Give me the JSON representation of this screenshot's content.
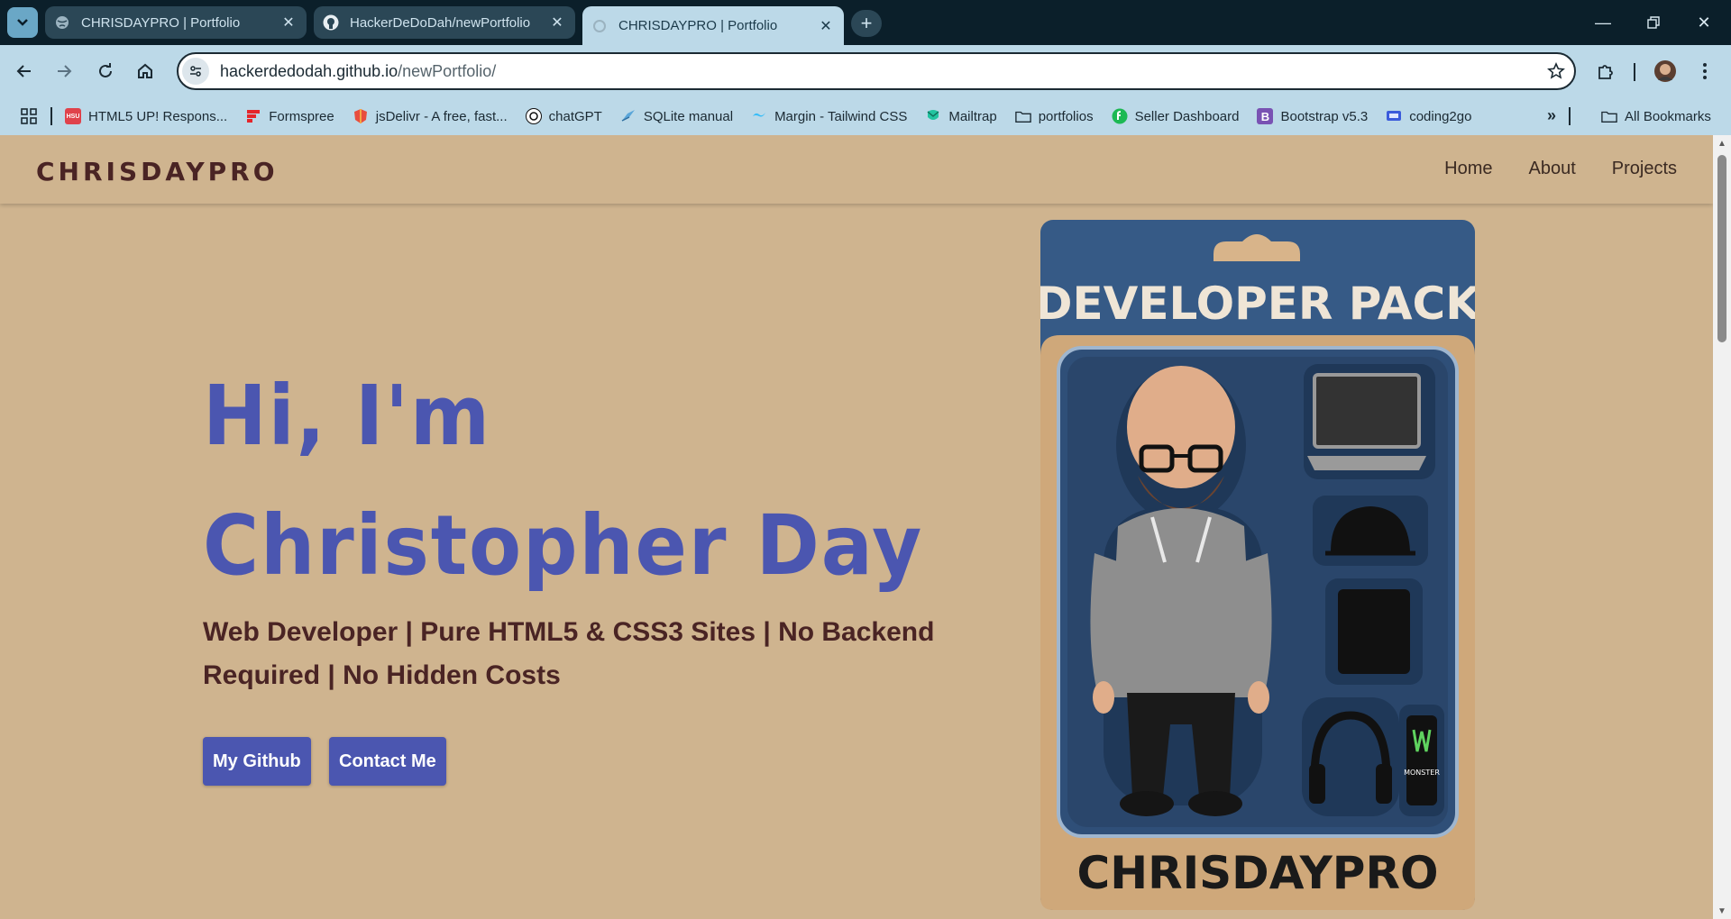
{
  "browser": {
    "tabs": [
      {
        "title": "CHRISDAYPRO | Portfolio",
        "favicon": "globe-icon",
        "active": false
      },
      {
        "title": "HackerDeDoDah/newPortfolio",
        "favicon": "github-icon",
        "active": false
      },
      {
        "title": "CHRISDAYPRO | Portfolio",
        "favicon": "loading-icon",
        "active": true
      }
    ],
    "url_domain": "hackerdedodah.github.io",
    "url_path": "/newPortfolio/",
    "bookmarks": [
      {
        "label": "HTML5 UP! Respons...",
        "icon": "html5up-icon",
        "color": "#e0424b"
      },
      {
        "label": "Formspree",
        "icon": "formspree-icon",
        "color": "#e5252a"
      },
      {
        "label": "jsDelivr - A free, fast...",
        "icon": "jsdelivr-icon",
        "color": "#e84d3d"
      },
      {
        "label": "chatGPT",
        "icon": "openai-icon",
        "color": "#111111"
      },
      {
        "label": "SQLite manual",
        "icon": "sqlite-icon",
        "color": "#5aa6d9"
      },
      {
        "label": "Margin - Tailwind CSS",
        "icon": "tailwind-icon",
        "color": "#38bdf8"
      },
      {
        "label": "Mailtrap",
        "icon": "mailtrap-icon",
        "color": "#22c4a0"
      },
      {
        "label": "portfolios",
        "icon": "folder-icon",
        "color": "#1b2a33"
      },
      {
        "label": "Seller Dashboard",
        "icon": "seller-icon",
        "color": "#1db954"
      },
      {
        "label": "Bootstrap v5.3",
        "icon": "bootstrap-icon",
        "color": "#7952b3"
      },
      {
        "label": "coding2go",
        "icon": "coding2go-icon",
        "color": "#3b5bdb"
      }
    ],
    "all_bookmarks": "All Bookmarks"
  },
  "site": {
    "brand": "CHRISDAYPRO",
    "nav": [
      "Home",
      "About",
      "Projects"
    ],
    "hero_line1": "Hi, I'm",
    "hero_line2": "Christopher Day",
    "subtitle": "Web Developer | Pure HTML5 & CSS3 Sites | No Backend Required | No Hidden Costs",
    "btn_github": "My Github",
    "btn_contact": "Contact Me",
    "pack_title": "DEVELOPER PACK",
    "pack_brand": "CHRISDAYPRO",
    "can_text": "MONSTER",
    "colors": {
      "background": "#cfb48f",
      "accent": "#4b56b0",
      "brand_text": "#4a2424",
      "pack_blue": "#365a86"
    }
  }
}
